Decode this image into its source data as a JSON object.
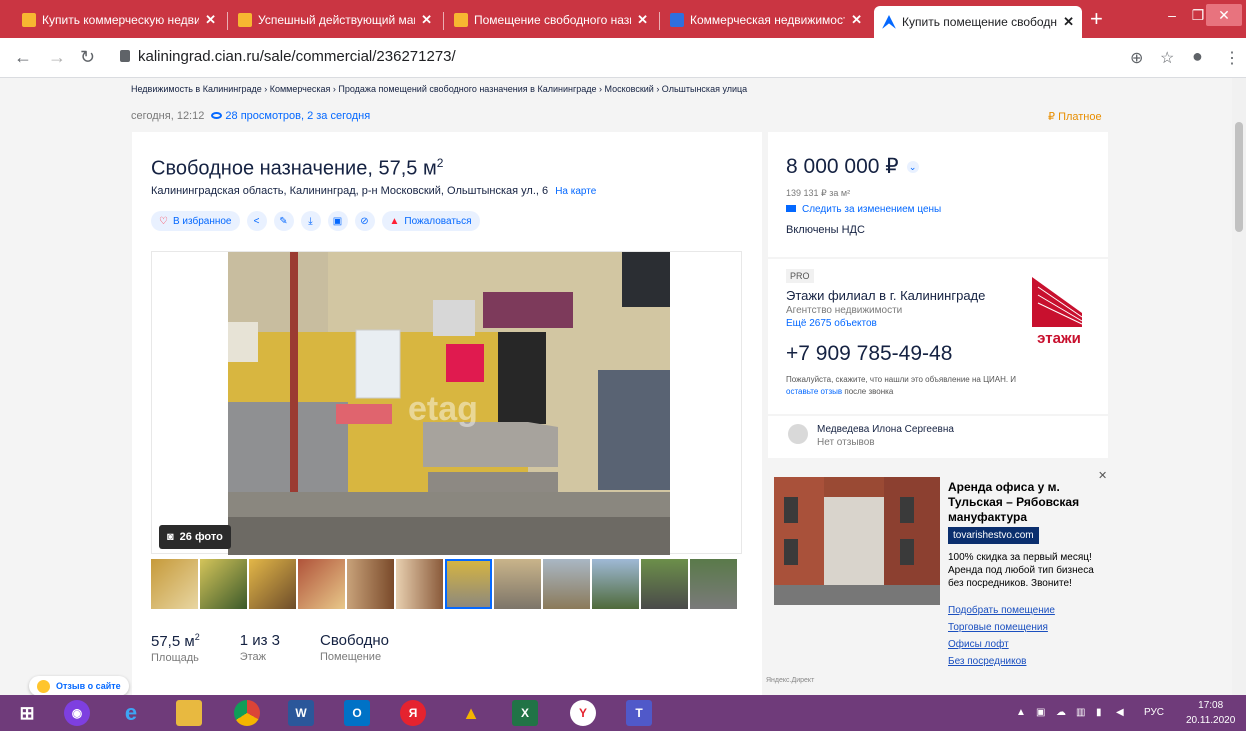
{
  "browser": {
    "tabs": [
      {
        "title": "Купить коммерческую недвиж"
      },
      {
        "title": "Успешный действующий мага"
      },
      {
        "title": "Помещение свободного назна"
      },
      {
        "title": "Коммерческая недвижимость"
      },
      {
        "title": "Купить помещение свободно"
      }
    ],
    "url": "kaliningrad.cian.ru/sale/commercial/236271273/"
  },
  "breadcrumbs": "Недвижимость в Калининграде  ›  Коммерческая  ›  Продажа помещений свободного назначения в Калининграде  ›  Московский  ›  Ольштынская улица",
  "meta": {
    "date": "сегодня, 12:12",
    "views": "28 просмотров, 2 за сегодня",
    "paid": "Платное"
  },
  "listing": {
    "title": "Свободное назначение, 57,5 м",
    "title_sup": "2",
    "address": "Калининградская область, Калининград, р-н Московский, Ольштынская ул., 6",
    "map_link": "На карте",
    "favorite": "В избранное",
    "report": "Пожаловаться",
    "photo_count": "26 фото",
    "watermark": "etag",
    "facts": [
      {
        "value": "57,5 м",
        "sup": "2",
        "label": "Площадь"
      },
      {
        "value": "1 из 3",
        "sup": "",
        "label": "Этаж"
      },
      {
        "value": "Свободно",
        "sup": "",
        "label": "Помещение"
      }
    ]
  },
  "price": {
    "value": "8 000 000 ₽",
    "per_m2": "139 131 ₽ за м²",
    "follow": "Следить за изменением цены",
    "vat": "Включены НДС"
  },
  "agent": {
    "badge": "PRO",
    "name": "Этажи филиал в г. Калининграде",
    "type": "Агентство недвижимости",
    "objects": "Ещё 2675 объектов",
    "phone": "+7 909 785-49-48",
    "note_1": "Пожалуйста, скажите, что нашли это объявление на ЦИАН. И",
    "note_link": "оставьте отзыв",
    "note_2": "после звонка",
    "logo_text": "этажи"
  },
  "realtor": {
    "name": "Медведева Илона Сергеевна",
    "reviews": "Нет отзывов"
  },
  "ad": {
    "title": "Аренда офиса у м. Тульская – Рябовская мануфактура",
    "domain": "tovarishestvo.com",
    "text": "100% скидка за первый месяц! Аренда под любой тип бизнеса без посредников. Звоните!",
    "links": [
      "Подобрать помещение",
      "Торговые помещения",
      "Офисы лофт",
      "Без посредников"
    ],
    "source": "Яндекс.Директ"
  },
  "feedback": "Отзыв о сайте",
  "taskbar": {
    "lang": "РУС",
    "time": "17:08",
    "date": "20.11.2020"
  }
}
